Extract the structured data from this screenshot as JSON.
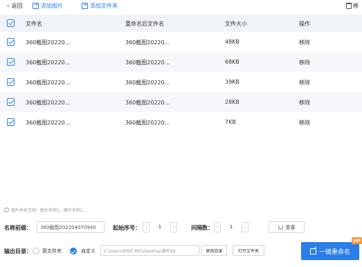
{
  "toolbar": {
    "back_label": "返回",
    "add_image_label": "添加图片",
    "add_folder_label": "添加文件夹",
    "remove_label": "移"
  },
  "table": {
    "headers": {
      "name": "文件名",
      "new_name": "重命名后文件名",
      "size": "文件大小",
      "op": "操作"
    },
    "rows": [
      {
        "name": "360截图20220...",
        "new_name": "360截图20220...",
        "size": "48KB",
        "op": "移除",
        "checked": true
      },
      {
        "name": "360截图20220...",
        "new_name": "360截图20220...",
        "size": "68KB",
        "op": "移除",
        "checked": true
      },
      {
        "name": "360截图20220...",
        "new_name": "360截图20220...",
        "size": "39KB",
        "op": "移除",
        "checked": true
      },
      {
        "name": "360截图20220...",
        "new_name": "360截图20220...",
        "size": "28KB",
        "op": "移除",
        "checked": true
      },
      {
        "name": "360截图20220...",
        "new_name": "360截图20220...",
        "size": "7KB",
        "op": "移除",
        "checked": true
      }
    ]
  },
  "hint": "图片命名示例：图片名称1、图片名称2...",
  "settings": {
    "prefix_label": "名称前缀：",
    "prefix_value": "360截图202204070940",
    "start_label": "起始序号：",
    "start_value": "1",
    "interval_label": "间隔数：",
    "interval_value": "1",
    "reset_label": "重置"
  },
  "output": {
    "label": "输出目录：",
    "option_original": "原文件夹",
    "option_custom": "自定义",
    "selected": "自定义",
    "path_value": "C:\\Users\\NING MEI\\Desktop\\图片99",
    "change_dir_label": "更改目录",
    "open_folder_label": "打开文件夹"
  },
  "action": {
    "rename_label": "一键重命名",
    "badge": "VIP"
  },
  "colors": {
    "accent": "#2b7de9",
    "vip": "#f29a38"
  }
}
